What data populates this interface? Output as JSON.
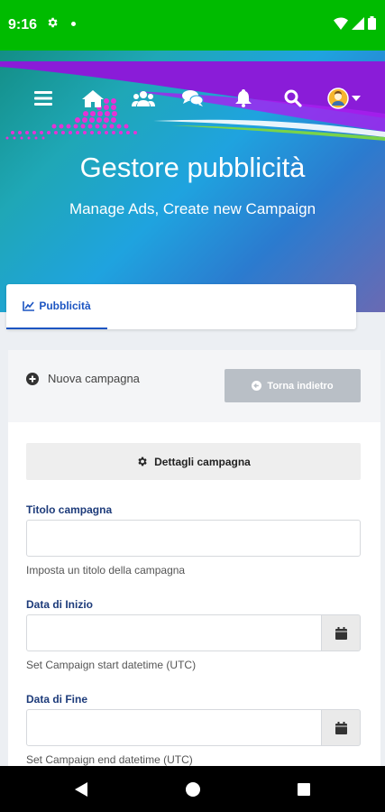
{
  "status_bar": {
    "time": "9:16"
  },
  "header": {
    "title": "Gestore pubblicità",
    "subtitle": "Manage Ads, Create new Campaign"
  },
  "nav": {
    "icons": [
      "menu-icon",
      "home-icon",
      "users-icon",
      "chat-icon",
      "bell-icon",
      "search-icon",
      "avatar"
    ]
  },
  "tabs": [
    {
      "label": "Pubblicità",
      "icon": "chart-icon",
      "active": true
    }
  ],
  "card": {
    "new_campaign_label": "Nuova campagna",
    "back_button_label": "Torna indietro",
    "section_label": "Dettagli campagna",
    "fields": {
      "title": {
        "label": "Titolo campagna",
        "value": "",
        "help": "Imposta un titolo della campagna"
      },
      "start": {
        "label": "Data di Inizio",
        "value": "",
        "help": "Set Campaign start datetime (UTC)"
      },
      "end": {
        "label": "Data di Fine",
        "value": "",
        "help": "Set Campaign end datetime (UTC)"
      }
    }
  },
  "colors": {
    "status_bar": "#00bb00",
    "accent": "#1c55c2",
    "label": "#1d3b7a",
    "back_button": "#b9bfc6"
  }
}
